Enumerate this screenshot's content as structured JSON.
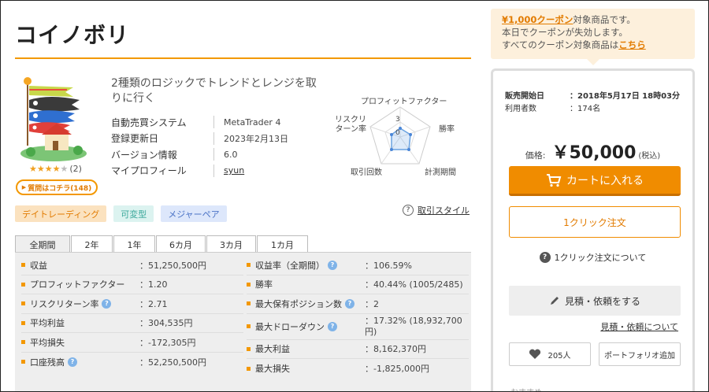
{
  "product": {
    "title": "コイノボリ",
    "description": "2種類のロジックでトレンドとレンジを取りに行く",
    "rating_stars": "★★★★★",
    "rating_count": "(2)",
    "rating_value": 4,
    "question_button": "質問はコチラ(148)",
    "info": [
      {
        "label": "自動売買システム",
        "value": "MetaTrader 4"
      },
      {
        "label": "登録更新日",
        "value": "2023年2月13日"
      },
      {
        "label": "バージョン情報",
        "value": "6.0"
      },
      {
        "label": "マイプロフィール",
        "value": "syun"
      }
    ],
    "radar": {
      "labels": {
        "pf": "プロフィットファクター",
        "win": "勝率",
        "period": "計測期間",
        "count": "取引回数",
        "rr": "リスクリターン率"
      },
      "scale_max": "3",
      "scale_zero": "0"
    },
    "tags": [
      "デイトレーディング",
      "可変型",
      "メジャーペア"
    ],
    "trade_style": "取引スタイル"
  },
  "tabs": [
    "全期間",
    "2年",
    "1年",
    "6カ月",
    "3カ月",
    "1カ月"
  ],
  "stats_left": [
    {
      "label": "収益",
      "value": "：51,250,500円",
      "help": false
    },
    {
      "label": "プロフィットファクター",
      "value": "：1.20",
      "help": false
    },
    {
      "label": "リスクリターン率",
      "value": "：2.71",
      "help": true
    },
    {
      "label": "平均利益",
      "value": "：304,535円",
      "help": false
    },
    {
      "label": "平均損失",
      "value": "：-172,305円",
      "help": false
    },
    {
      "label": "口座残高",
      "value": "：52,250,500円",
      "help": true
    }
  ],
  "stats_right": [
    {
      "label": "収益率（全期間）",
      "value": "：106.59%",
      "help": true
    },
    {
      "label": "勝率",
      "value": "：40.44% (1005/2485)",
      "help": false
    },
    {
      "label": "最大保有ポジション数",
      "value": "：2",
      "help": true
    },
    {
      "label": "最大ドローダウン",
      "value": "：17.32% (18,932,700円)",
      "help": true
    },
    {
      "label": "最大利益",
      "value": "：8,162,370円",
      "help": false
    },
    {
      "label": "最大損失",
      "value": "：-1,825,000円",
      "help": false
    }
  ],
  "coupon": {
    "highlight": "¥1,000クーポン",
    "line1_rest": "対象商品です。",
    "line2": "本日でクーポンが失効します。",
    "line3_prefix": "すべてのクーポン対象商品は",
    "line3_link": "こちら"
  },
  "purchase": {
    "sale_start_label": "販売開始日",
    "sale_start_value": "：2018年5月17日 18時03分",
    "users_label": "利用者数",
    "users_value": "：174名",
    "price_label": "価格:",
    "price_value": "￥50,000",
    "tax": "(税込)",
    "cart_button": "カートに入れる",
    "oneclick_button": "1クリック注文",
    "oneclick_about": "1クリック注文について",
    "quote_button": "見積・依頼をする",
    "quote_about": "見積・依頼について",
    "like_count": "205人",
    "portfolio_button": "ポートフォリオ追加",
    "cut_text": "おすすめ"
  },
  "colors": {
    "accent": "#f39800",
    "cart": "#f08c00",
    "help": "#7fb3e8"
  }
}
